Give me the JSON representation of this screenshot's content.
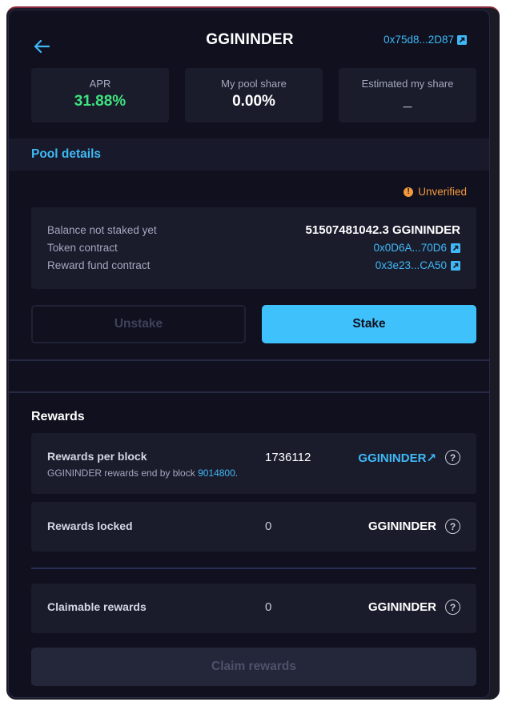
{
  "header": {
    "title": "GGININDER",
    "address_link": "0x75d8...2D87",
    "back_icon": "arrow-left-icon",
    "link_icon": "external-link-icon"
  },
  "stats": [
    {
      "label": "APR",
      "value": "31.88%"
    },
    {
      "label": "My pool share",
      "value": "0.00%"
    },
    {
      "label": "Estimated my share",
      "value": "_"
    }
  ],
  "pool_details": {
    "heading": "Pool details",
    "status": "Unverified",
    "status_icon": "exclamation-icon",
    "rows": [
      {
        "label": "Balance not staked yet",
        "value": "51507481042.3 GGININDER"
      },
      {
        "label": "Token contract",
        "value": "0x0D6A...70D6"
      },
      {
        "label": "Reward fund contract",
        "value": "0x3e23...CA50"
      }
    ]
  },
  "actions": {
    "unstake_label": "Unstake",
    "stake_label": "Stake"
  },
  "rewards": {
    "heading": "Rewards",
    "per_block": {
      "label": "Rewards per block",
      "sub_prefix": "GGININDER rewards end by block ",
      "end_block": "9014800",
      "sub_suffix": ".",
      "value": "1736112",
      "token": "GGININDER↗"
    },
    "locked": {
      "label": "Rewards locked",
      "value": "0",
      "token": "GGININDER"
    },
    "claimable": {
      "label": "Claimable rewards",
      "value": "0",
      "token": "GGININDER"
    },
    "help_glyph": "?",
    "claim_label": "Claim rewards"
  },
  "colors": {
    "accent": "#3fb8f5",
    "apr_green": "#3ee27e",
    "warning": "#f29a3a",
    "panel_bg": "#10101f",
    "card_bg": "#1a1c2c"
  }
}
